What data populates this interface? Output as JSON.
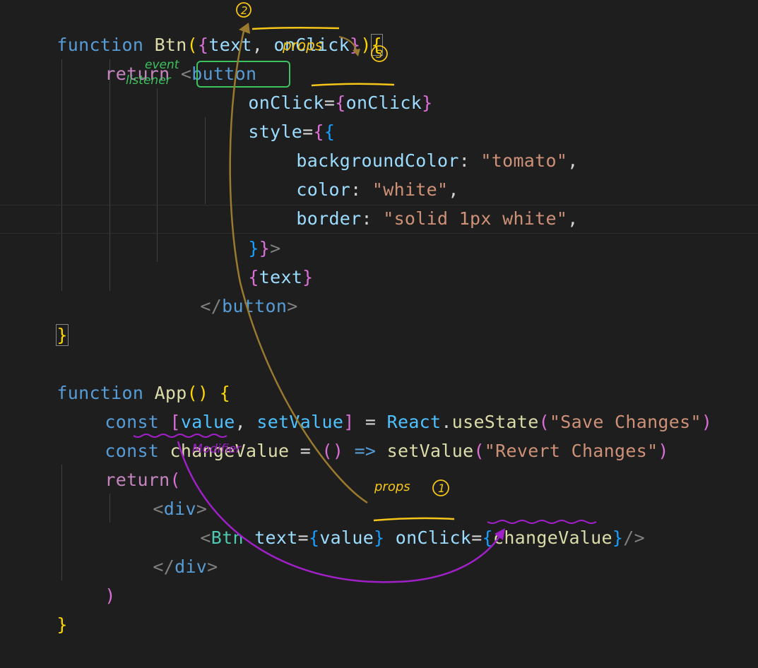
{
  "code": {
    "l1": {
      "kw": "function",
      "name": "Btn",
      "p1": "(",
      "b1": "{",
      "arg1": "text",
      "comma": ",",
      "arg2": "onClick",
      "b2": "}",
      "p2": ")",
      "b3": "{"
    },
    "l2": {
      "kw": "return",
      "lt": "<",
      "tag": "button"
    },
    "l3": {
      "attr": "onClick",
      "eq": "=",
      "b1": "{",
      "val": "onClick",
      "b2": "}"
    },
    "l4": {
      "attr": "style",
      "eq": "=",
      "b1": "{",
      "b2": "{"
    },
    "l5": {
      "key": "backgroundColor",
      "colon": ":",
      "val": "\"tomato\"",
      "comma": ","
    },
    "l6": {
      "key": "color",
      "colon": ":",
      "val": "\"white\"",
      "comma": ","
    },
    "l7": {
      "key": "border",
      "colon": ":",
      "val": "\"solid 1px white\"",
      "comma": ","
    },
    "l8": {
      "b1": "}",
      "b2": "}",
      "gt": ">"
    },
    "l9": {
      "b1": "{",
      "val": "text",
      "b2": "}"
    },
    "l10": {
      "open": "</",
      "tag": "button",
      "close": ">"
    },
    "l11": {
      "b": "}"
    },
    "l13": {
      "kw": "function",
      "name": "App",
      "p1": "(",
      "p2": ")",
      "b": "{"
    },
    "l14": {
      "kw": "const",
      "br1": "[",
      "v1": "value",
      "comma": ",",
      "v2": "setValue",
      "br2": "]",
      "eq": "=",
      "obj": "React",
      "dot": ".",
      "fn": "useState",
      "p1": "(",
      "str": "\"Save Changes\"",
      "p2": ")"
    },
    "l15": {
      "kw": "const",
      "name": "changeValue",
      "eq": "=",
      "p1": "(",
      "p2": ")",
      "arrow": "=>",
      "fn": "setValue",
      "p3": "(",
      "str": "\"Revert Changes\"",
      "p4": ")"
    },
    "l16": {
      "kw": "return",
      "p": "("
    },
    "l17": {
      "lt": "<",
      "tag": "div",
      "gt": ">"
    },
    "l18": {
      "lt": "<",
      "comp": "Btn",
      "a1": "text",
      "eq1": "=",
      "b1": "{",
      "v1": "value",
      "b2": "}",
      "a2": "onClick",
      "eq2": "=",
      "b3": "{",
      "v2": "changeValue",
      "b4": "}",
      "end": "/>"
    },
    "l19": {
      "open": "</",
      "tag": "div",
      "gt": ">"
    },
    "l20": {
      "p": ")"
    },
    "l21": {
      "b": "}"
    }
  },
  "annotations": {
    "event_listener": [
      "event",
      "listener"
    ],
    "props_top": "props",
    "props_bottom": "props",
    "modifier": "Modifier",
    "step1": "1",
    "step2": "2",
    "step3": "3"
  },
  "colors": {
    "background": "#1e1e1e",
    "annotation_yellow": "#f5c518",
    "annotation_brown": "#9a7a2e",
    "annotation_green": "#3cc25e",
    "annotation_purple": "#a020c8"
  }
}
